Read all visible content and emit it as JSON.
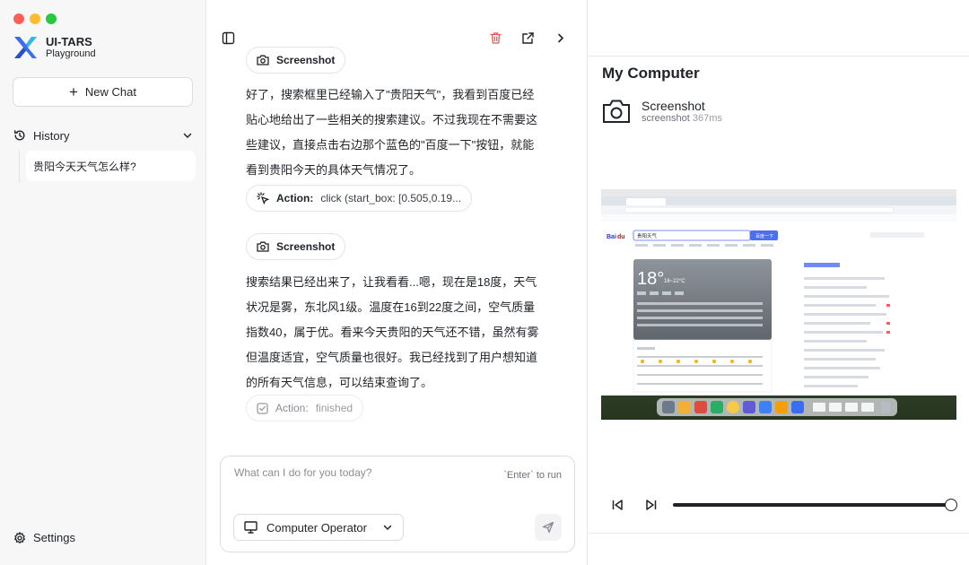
{
  "app": {
    "name": "UI-TARS",
    "subtitle": "Playground"
  },
  "sidebar": {
    "new_chat": "New Chat",
    "history_label": "History",
    "history_items": [
      "贵阳今天天气怎么样?"
    ],
    "settings": "Settings"
  },
  "chat": {
    "steps": [
      {
        "kind": "screenshot",
        "label": "Screenshot"
      },
      {
        "kind": "message",
        "text": "好了，搜索框里已经输入了\"贵阳天气\"，我看到百度已经贴心地给出了一些相关的搜索建议。不过我现在不需要这些建议，直接点击右边那个蓝色的\"百度一下\"按钮，就能看到贵阳今天的具体天气情况了。"
      },
      {
        "kind": "action",
        "label": "Action:",
        "value": "click (start_box: [0.505,0.19..."
      },
      {
        "kind": "screenshot",
        "label": "Screenshot"
      },
      {
        "kind": "message",
        "text": "搜索结果已经出来了，让我看看...嗯，现在是18度，天气状况是雾，东北风1级。温度在16到22度之间，空气质量指数40，属于优。看来今天贵阳的天气还不错，虽然有雾但温度适宜，空气质量也很好。我已经找到了用户想知道的所有天气信息，可以结束查询了。"
      },
      {
        "kind": "action_finished",
        "label": "Action:",
        "value": "finished"
      }
    ],
    "composer": {
      "placeholder": "What can I do for you today?",
      "hint": "`Enter` to run",
      "operator": "Computer Operator"
    }
  },
  "computer": {
    "title": "My Computer",
    "screenshot_title": "Screenshot",
    "screenshot_type": "screenshot",
    "screenshot_duration": "367ms",
    "preview": {
      "search_query": "贵阳天气",
      "search_button": "百度一下",
      "temperature": "18°",
      "temp_range": "16~22°C"
    },
    "playback_progress": 1.0
  },
  "colors": {
    "accent": "#1f2328",
    "danger": "#e05a5a",
    "brand_blue": "#3a6df0"
  }
}
